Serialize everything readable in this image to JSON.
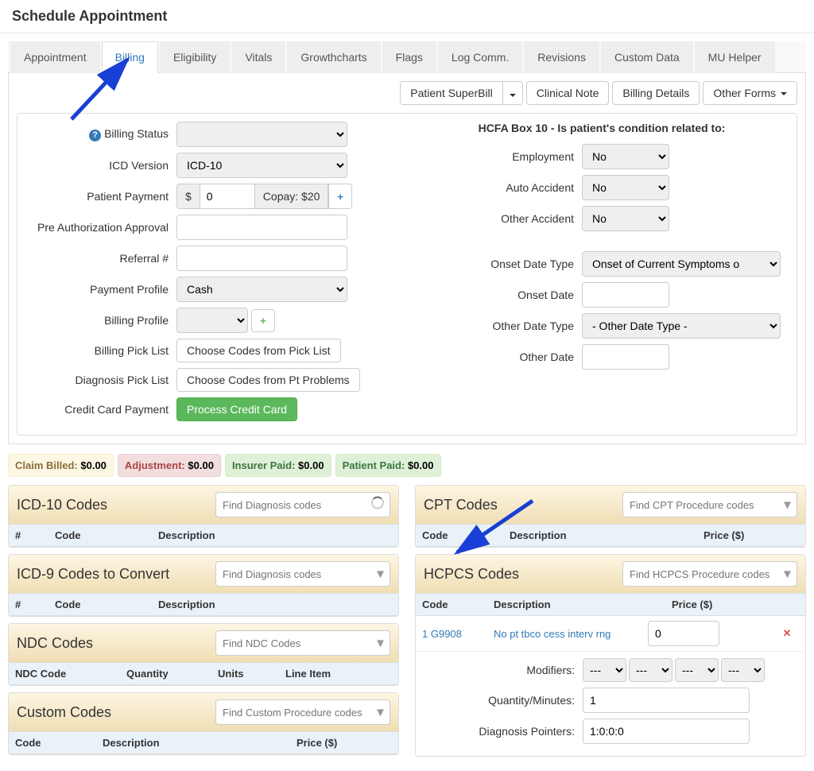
{
  "header": {
    "title": "Schedule Appointment"
  },
  "tabs": {
    "items": [
      {
        "label": "Appointment"
      },
      {
        "label": "Billing"
      },
      {
        "label": "Eligibility"
      },
      {
        "label": "Vitals"
      },
      {
        "label": "Growthcharts"
      },
      {
        "label": "Flags"
      },
      {
        "label": "Log Comm."
      },
      {
        "label": "Revisions"
      },
      {
        "label": "Custom Data"
      },
      {
        "label": "MU Helper"
      }
    ],
    "active_index": 1
  },
  "top_buttons": {
    "superbill": "Patient SuperBill",
    "clinical": "Clinical Note",
    "details": "Billing Details",
    "other_forms": "Other Forms"
  },
  "billing_form": {
    "billing_status_label": "Billing Status",
    "icd_version_label": "ICD Version",
    "icd_version_value": "ICD-10",
    "patient_payment_label": "Patient Payment",
    "patient_payment_value": "0",
    "copay_text": "Copay: $20",
    "preauth_label": "Pre Authorization Approval",
    "referral_label": "Referral #",
    "payment_profile_label": "Payment Profile",
    "payment_profile_value": "Cash",
    "billing_profile_label": "Billing Profile",
    "billing_picklist_label": "Billing Pick List",
    "billing_picklist_btn": "Choose Codes from Pick List",
    "dx_picklist_label": "Diagnosis Pick List",
    "dx_picklist_btn": "Choose Codes from Pt Problems",
    "credit_label": "Credit Card Payment",
    "credit_btn": "Process Credit Card"
  },
  "hcfa": {
    "heading": "HCFA Box 10 - Is patient's condition related to:",
    "employment_label": "Employment",
    "employment_value": "No",
    "auto_label": "Auto Accident",
    "auto_value": "No",
    "other_acc_label": "Other Accident",
    "other_acc_value": "No",
    "onset_type_label": "Onset Date Type",
    "onset_type_value": "Onset of Current Symptoms o",
    "onset_date_label": "Onset Date",
    "other_type_label": "Other Date Type",
    "other_type_value": "- Other Date Type -",
    "other_date_label": "Other Date"
  },
  "status_badges": {
    "claim_label": "Claim Billed:",
    "claim_value": "$0.00",
    "adj_label": "Adjustment:",
    "adj_value": "$0.00",
    "ins_label": "Insurer Paid:",
    "ins_value": "$0.00",
    "pt_label": "Patient Paid:",
    "pt_value": "$0.00"
  },
  "panels": {
    "icd10": {
      "title": "ICD-10 Codes",
      "placeholder": "Find Diagnosis codes",
      "cols": {
        "num": "#",
        "code": "Code",
        "desc": "Description"
      }
    },
    "icd9": {
      "title": "ICD-9 Codes to Convert",
      "placeholder": "Find Diagnosis codes",
      "cols": {
        "num": "#",
        "code": "Code",
        "desc": "Description"
      }
    },
    "ndc": {
      "title": "NDC Codes",
      "placeholder": "Find NDC Codes",
      "cols": {
        "code": "NDC Code",
        "qty": "Quantity",
        "units": "Units",
        "line": "Line Item"
      }
    },
    "custom": {
      "title": "Custom Codes",
      "placeholder": "Find Custom Procedure codes",
      "cols": {
        "code": "Code",
        "desc": "Description",
        "price": "Price ($)"
      }
    },
    "cpt": {
      "title": "CPT Codes",
      "placeholder": "Find CPT Procedure codes",
      "cols": {
        "code": "Code",
        "desc": "Description",
        "price": "Price ($)"
      }
    },
    "hcpcs": {
      "title": "HCPCS Codes",
      "placeholder": "Find HCPCS Procedure codes",
      "cols": {
        "code": "Code",
        "desc": "Description",
        "price": "Price ($)"
      },
      "row": {
        "num": "1",
        "code": "G9908",
        "desc": "No pt tbco cess interv rng",
        "price": "0"
      },
      "modifiers_label": "Modifiers:",
      "modifier_option": "---",
      "qty_label": "Quantity/Minutes:",
      "qty_value": "1",
      "dxptr_label": "Diagnosis Pointers:",
      "dxptr_value": "1:0:0:0"
    }
  }
}
